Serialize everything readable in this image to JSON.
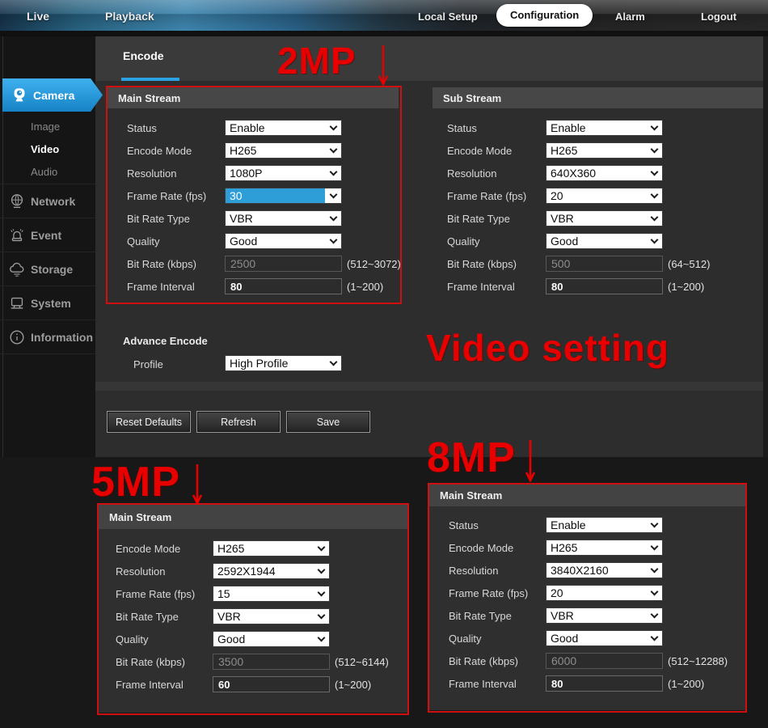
{
  "nav": {
    "live": "Live",
    "playback": "Playback",
    "local_setup": "Local Setup",
    "configuration": "Configuration",
    "alarm": "Alarm",
    "logout": "Logout"
  },
  "sidebar": {
    "camera": "Camera",
    "image": "Image",
    "video": "Video",
    "audio": "Audio",
    "network": "Network",
    "event": "Event",
    "storage": "Storage",
    "system": "System",
    "information": "Information"
  },
  "tabs": {
    "encode": "Encode"
  },
  "panels": {
    "main_stream": {
      "title": "Main Stream",
      "rows": [
        {
          "label": "Status",
          "control": "select",
          "value": "Enable"
        },
        {
          "label": "Encode Mode",
          "control": "select",
          "value": "H265"
        },
        {
          "label": "Resolution",
          "control": "select",
          "value": "1080P"
        },
        {
          "label": "Frame Rate (fps)",
          "control": "select",
          "value": "30",
          "state": "highlight"
        },
        {
          "label": "Bit Rate Type",
          "control": "select",
          "value": "VBR"
        },
        {
          "label": "Quality",
          "control": "select",
          "value": "Good"
        },
        {
          "label": "Bit Rate (kbps)",
          "control": "input",
          "value": "2500",
          "hint": "(512~3072)",
          "state": "disabled"
        },
        {
          "label": "Frame Interval",
          "control": "input",
          "value": "80",
          "hint": "(1~200)"
        }
      ]
    },
    "sub_stream": {
      "title": "Sub Stream",
      "rows": [
        {
          "label": "Status",
          "control": "select",
          "value": "Enable"
        },
        {
          "label": "Encode Mode",
          "control": "select",
          "value": "H265"
        },
        {
          "label": "Resolution",
          "control": "select",
          "value": "640X360"
        },
        {
          "label": "Frame Rate (fps)",
          "control": "select",
          "value": "20"
        },
        {
          "label": "Bit Rate Type",
          "control": "select",
          "value": "VBR"
        },
        {
          "label": "Quality",
          "control": "select",
          "value": "Good"
        },
        {
          "label": "Bit Rate (kbps)",
          "control": "input",
          "value": "500",
          "hint": "(64~512)",
          "state": "disabled"
        },
        {
          "label": "Frame Interval",
          "control": "input",
          "value": "80",
          "hint": "(1~200)"
        }
      ]
    },
    "five_mp": {
      "title": "Main Stream",
      "rows": [
        {
          "label": "Encode Mode",
          "control": "select",
          "value": "H265"
        },
        {
          "label": "Resolution",
          "control": "select",
          "value": "2592X1944"
        },
        {
          "label": "Frame Rate (fps)",
          "control": "select",
          "value": "15"
        },
        {
          "label": "Bit Rate Type",
          "control": "select",
          "value": "VBR"
        },
        {
          "label": "Quality",
          "control": "select",
          "value": "Good"
        },
        {
          "label": "Bit Rate (kbps)",
          "control": "input",
          "value": "3500",
          "hint": "(512~6144)",
          "state": "disabled"
        },
        {
          "label": "Frame Interval",
          "control": "input",
          "value": "60",
          "hint": "(1~200)"
        }
      ]
    },
    "eight_mp": {
      "title": "Main Stream",
      "rows": [
        {
          "label": "Status",
          "control": "select",
          "value": "Enable"
        },
        {
          "label": "Encode Mode",
          "control": "select",
          "value": "H265"
        },
        {
          "label": "Resolution",
          "control": "select",
          "value": "3840X2160"
        },
        {
          "label": "Frame Rate (fps)",
          "control": "select",
          "value": "20"
        },
        {
          "label": "Bit Rate Type",
          "control": "select",
          "value": "VBR"
        },
        {
          "label": "Quality",
          "control": "select",
          "value": "Good"
        },
        {
          "label": "Bit Rate (kbps)",
          "control": "input",
          "value": "6000",
          "hint": "(512~12288)",
          "state": "disabled"
        },
        {
          "label": "Frame Interval",
          "control": "input",
          "value": "80",
          "hint": "(1~200)"
        }
      ]
    }
  },
  "advance": {
    "title": "Advance Encode",
    "profile_label": "Profile",
    "profile_value": "High Profile"
  },
  "toolbar": {
    "reset": "Reset Defaults",
    "refresh": "Refresh",
    "save": "Save"
  },
  "annotations": {
    "mp2": "2MP",
    "mp5": "5MP",
    "mp8": "8MP",
    "video_setting": "Video setting"
  },
  "colors": {
    "accent_blue": "#2e9ed8",
    "annotation_red": "#e80000",
    "outline_red": "#d01010"
  }
}
